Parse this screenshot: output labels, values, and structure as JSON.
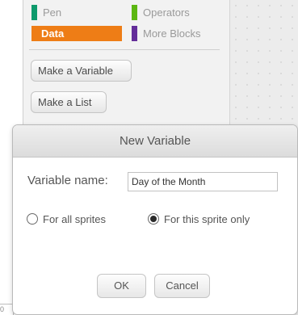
{
  "palette": {
    "categories": [
      {
        "label": "Pen",
        "color": "#0e9a6c"
      },
      {
        "label": "Operators",
        "color": "#5cb712"
      },
      {
        "label": "Data",
        "color": "#ee7d16",
        "selected": true
      },
      {
        "label": "More Blocks",
        "color": "#632d99"
      }
    ],
    "make_variable_label": "Make a Variable",
    "make_list_label": "Make a List"
  },
  "corner_value": "0",
  "dialog": {
    "title": "New Variable",
    "name_label": "Variable name:",
    "name_value": "Day of the Month",
    "radio_all_label": "For all sprites",
    "radio_this_label": "For this sprite only",
    "radio_selected": "For this sprite only",
    "ok_label": "OK",
    "cancel_label": "Cancel"
  }
}
